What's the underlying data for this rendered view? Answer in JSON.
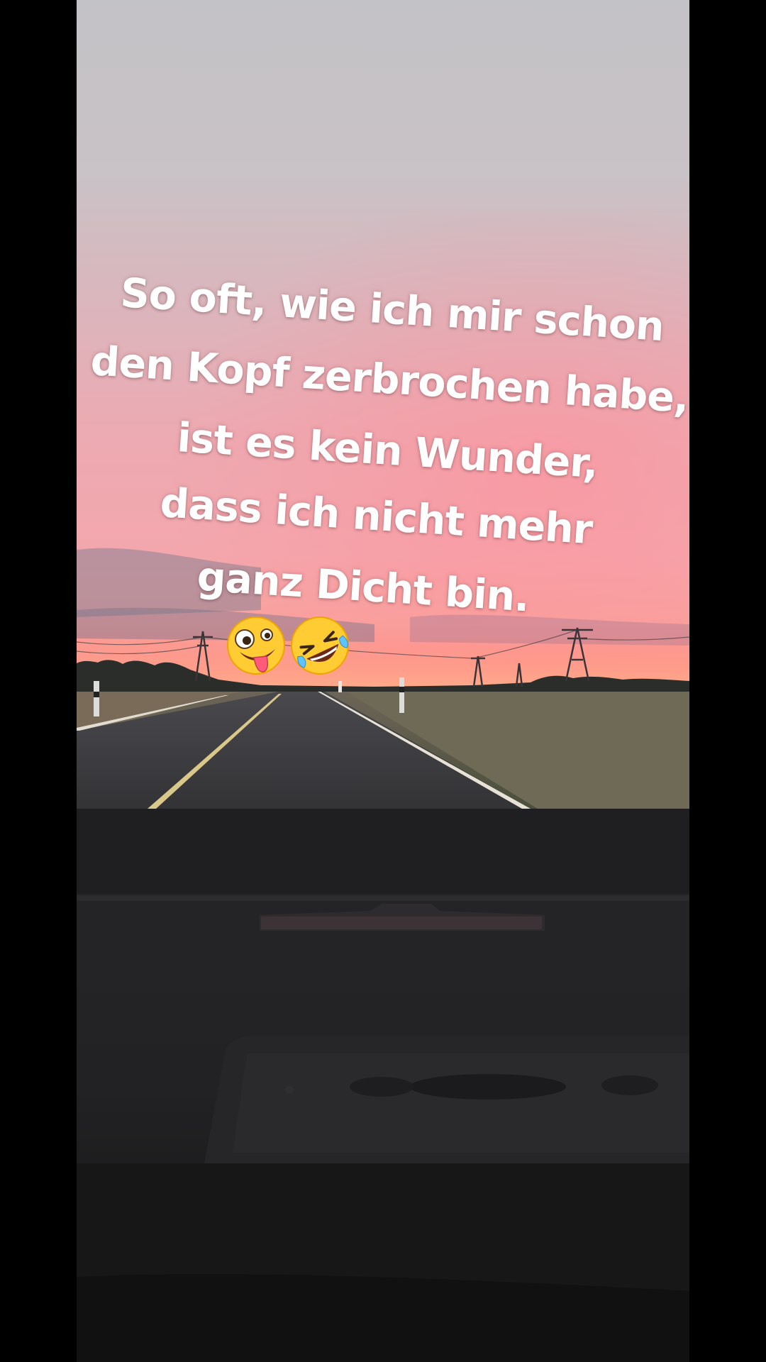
{
  "caption": {
    "lines": [
      "So oft, wie ich mir schon",
      "den Kopf zerbrochen habe,",
      "ist es kein Wunder,",
      "dass ich nicht mehr",
      "ganz Dicht  bin."
    ]
  },
  "emojis": [
    {
      "name": "zany-face-icon"
    },
    {
      "name": "rolling-on-floor-laughing-icon"
    }
  ],
  "colors": {
    "sky_top": "#c5c3c8",
    "sky_pink": "#f0a0a8",
    "sunset_glow": "#ff8f86",
    "road": "#3b3b3e",
    "dashboard": "#1c1c1e"
  }
}
